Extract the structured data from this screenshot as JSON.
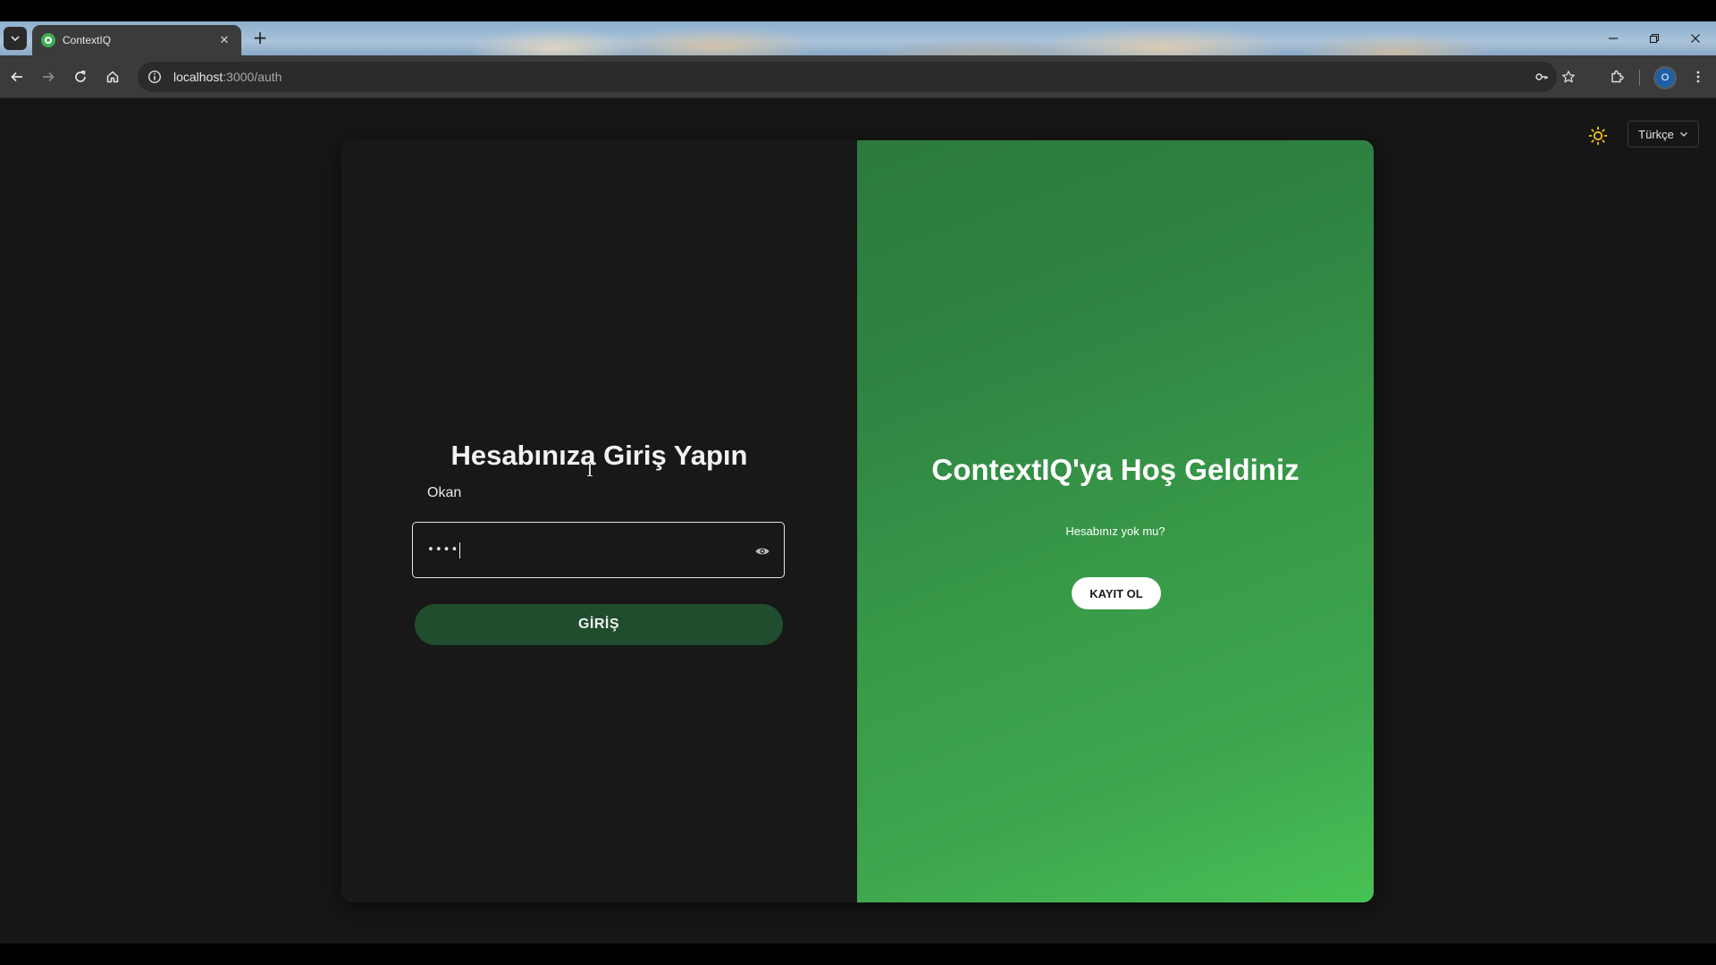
{
  "browser": {
    "tab_title": "ContextIQ",
    "tab_close": "✕",
    "new_tab": "+",
    "url_host": "localhost",
    "url_path": ":3000/auth",
    "profile_initial": "O"
  },
  "page": {
    "language": "Türkçe",
    "login": {
      "title": "Hesabınıza Giriş Yapın",
      "username_value": "Okan",
      "password_mask": "••••",
      "submit_label": "GİRİŞ"
    },
    "welcome": {
      "title": "ContextIQ'ya Hoş Geldiniz",
      "subtitle": "Hesabınız yok mu?",
      "signup_label": "KAYIT OL"
    }
  },
  "colors": {
    "accent_green_dark": "#1f4d2e",
    "accent_green": "#3ea54f",
    "background": "#161616"
  },
  "icons": [
    "tab-search-icon",
    "favicon-icon",
    "close-icon",
    "plus-icon",
    "minimize-icon",
    "restore-icon",
    "back-icon",
    "forward-icon",
    "reload-icon",
    "home-icon",
    "site-info-icon",
    "password-key-icon",
    "star-icon",
    "extensions-icon",
    "menu-icon",
    "sun-icon",
    "chevron-down-icon",
    "eye-icon"
  ]
}
